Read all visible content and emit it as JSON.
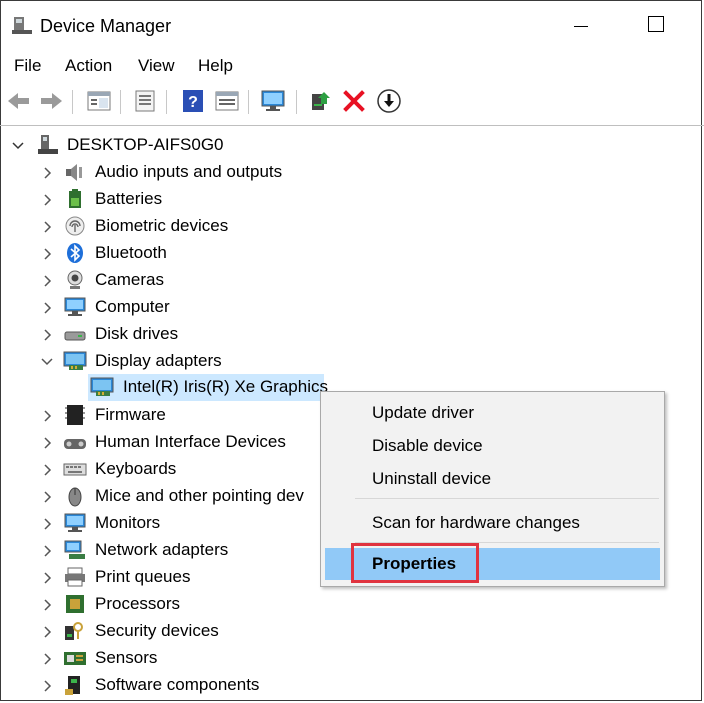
{
  "window": {
    "title": "Device Manager"
  },
  "menu": [
    "File",
    "Action",
    "View",
    "Help"
  ],
  "toolbar_icons": [
    "back-arrow-icon",
    "forward-arrow-icon",
    "show-hide-tree-icon",
    "properties-sheet-icon",
    "help-icon",
    "view-icon",
    "scan-monitor-icon",
    "update-driver-icon",
    "uninstall-x-icon",
    "download-icon"
  ],
  "tree": {
    "root": "DESKTOP-AIFS0G0",
    "categories": [
      {
        "label": "Audio inputs and outputs",
        "icon": "speaker-icon"
      },
      {
        "label": "Batteries",
        "icon": "battery-icon"
      },
      {
        "label": "Biometric devices",
        "icon": "fingerprint-icon"
      },
      {
        "label": "Bluetooth",
        "icon": "bluetooth-icon"
      },
      {
        "label": "Cameras",
        "icon": "camera-icon"
      },
      {
        "label": "Computer",
        "icon": "computer-icon"
      },
      {
        "label": "Disk drives",
        "icon": "disk-drive-icon"
      },
      {
        "label": "Display adapters",
        "icon": "display-adapter-icon",
        "expanded": true
      },
      {
        "label": "Firmware",
        "icon": "firmware-chip-icon"
      },
      {
        "label": "Human Interface Devices",
        "icon": "hid-icon"
      },
      {
        "label": "Keyboards",
        "icon": "keyboard-icon"
      },
      {
        "label": "Mice and other pointing dev",
        "icon": "mouse-icon"
      },
      {
        "label": "Monitors",
        "icon": "monitor-icon"
      },
      {
        "label": "Network adapters",
        "icon": "network-adapter-icon"
      },
      {
        "label": "Print queues",
        "icon": "printer-icon"
      },
      {
        "label": "Processors",
        "icon": "processor-icon"
      },
      {
        "label": "Security devices",
        "icon": "security-device-icon"
      },
      {
        "label": "Sensors",
        "icon": "sensor-icon"
      },
      {
        "label": "Software components",
        "icon": "software-component-icon"
      }
    ],
    "child": {
      "label": "Intel(R) Iris(R) Xe Graphics",
      "icon": "display-adapter-icon"
    }
  },
  "context_menu": {
    "items": [
      "Update driver",
      "Disable device",
      "Uninstall device",
      "Scan for hardware changes",
      "Properties"
    ],
    "highlighted": "Properties"
  },
  "colors": {
    "selection": "#cce8ff",
    "menu_highlight": "#91c9f7",
    "annotation": "#e0333f"
  }
}
